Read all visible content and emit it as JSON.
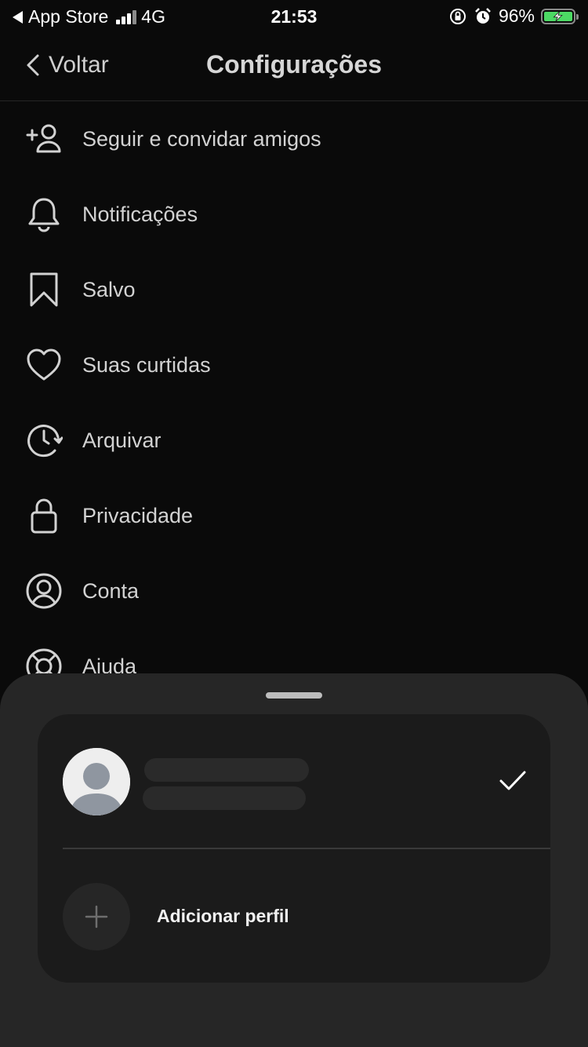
{
  "status_bar": {
    "back_app": "App Store",
    "network": "4G",
    "time": "21:53",
    "battery": "96%"
  },
  "nav": {
    "back_label": "Voltar",
    "title": "Configurações"
  },
  "menu": {
    "items": [
      {
        "label": "Seguir e convidar amigos",
        "icon": "add-user-icon"
      },
      {
        "label": "Notificações",
        "icon": "bell-icon"
      },
      {
        "label": "Salvo",
        "icon": "bookmark-icon"
      },
      {
        "label": "Suas curtidas",
        "icon": "heart-icon"
      },
      {
        "label": "Arquivar",
        "icon": "archive-clock-icon"
      },
      {
        "label": "Privacidade",
        "icon": "lock-icon"
      },
      {
        "label": "Conta",
        "icon": "account-icon"
      },
      {
        "label": "Ajuda",
        "icon": "help-lifebuoy-icon"
      }
    ]
  },
  "sheet": {
    "add_profile_label": "Adicionar perfil"
  },
  "colors": {
    "background": "#0a0a0a",
    "sheet": "#262626",
    "card": "#1b1b1b",
    "battery_fill": "#4cd964"
  }
}
